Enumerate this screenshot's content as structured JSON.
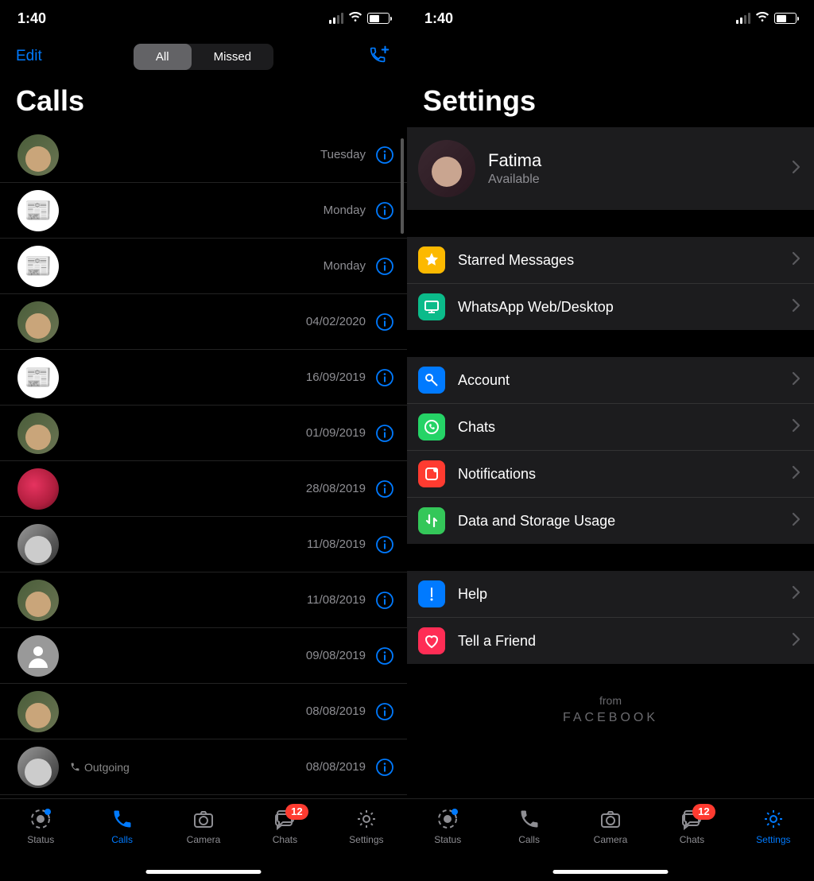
{
  "statusBar": {
    "time": "1:40"
  },
  "callsScreen": {
    "edit": "Edit",
    "segAll": "All",
    "segMissed": "Missed",
    "title": "Calls",
    "calls": [
      {
        "date": "Tuesday",
        "avatar": "person1"
      },
      {
        "date": "Monday",
        "avatar": "news"
      },
      {
        "date": "Monday",
        "avatar": "news"
      },
      {
        "date": "04/02/2020",
        "avatar": "person1"
      },
      {
        "date": "16/09/2019",
        "avatar": "news"
      },
      {
        "date": "01/09/2019",
        "avatar": "person1"
      },
      {
        "date": "28/08/2019",
        "avatar": "rose"
      },
      {
        "date": "11/08/2019",
        "avatar": "bw"
      },
      {
        "date": "11/08/2019",
        "avatar": "person1"
      },
      {
        "date": "09/08/2019",
        "avatar": "placeholder"
      },
      {
        "date": "08/08/2019",
        "avatar": "person1"
      },
      {
        "date": "08/08/2019",
        "avatar": "bw",
        "sub": "Outgoing"
      }
    ]
  },
  "settingsScreen": {
    "title": "Settings",
    "profile": {
      "name": "Fatima",
      "status": "Available"
    },
    "group1": [
      {
        "label": "Starred Messages",
        "icon": "star"
      },
      {
        "label": "WhatsApp Web/Desktop",
        "icon": "desktop"
      }
    ],
    "group2": [
      {
        "label": "Account",
        "icon": "key"
      },
      {
        "label": "Chats",
        "icon": "whatsapp"
      },
      {
        "label": "Notifications",
        "icon": "notif"
      },
      {
        "label": "Data and Storage Usage",
        "icon": "data"
      }
    ],
    "group3": [
      {
        "label": "Help",
        "icon": "help"
      },
      {
        "label": "Tell a Friend",
        "icon": "heart"
      }
    ],
    "brand": {
      "from": "from",
      "name": "FACEBOOK"
    }
  },
  "tabs": {
    "status": "Status",
    "calls": "Calls",
    "camera": "Camera",
    "chats": "Chats",
    "settings": "Settings",
    "chatsBadge": "12"
  }
}
